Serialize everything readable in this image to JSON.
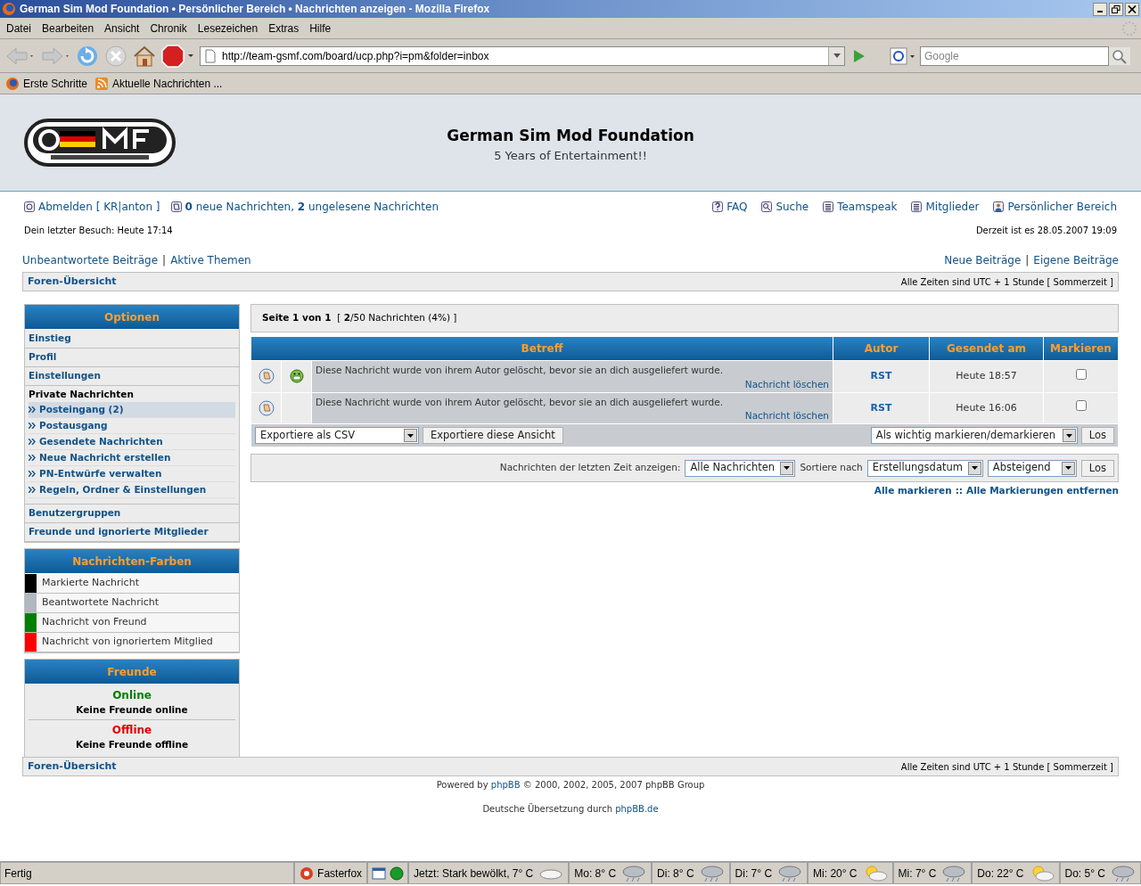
{
  "window": {
    "title": "German Sim Mod Foundation • Persönlicher Bereich • Nachrichten anzeigen - Mozilla Firefox"
  },
  "menu": [
    "Datei",
    "Bearbeiten",
    "Ansicht",
    "Chronik",
    "Lesezeichen",
    "Extras",
    "Hilfe"
  ],
  "toolbar": {
    "url": "http://team-gsmf.com/board/ucp.php?i=pm&folder=inbox",
    "search_placeholder": "Google"
  },
  "bookmarks": [
    "Erste Schritte",
    "Aktuelle Nachrichten ..."
  ],
  "header": {
    "title": "German Sim Mod Foundation",
    "subtitle": "5 Years of Entertainment!!"
  },
  "nav": {
    "logout": "Abmelden [ KR|anton ]",
    "messages": "**0** neue Nachrichten, **2** ungelesene Nachrichten",
    "right": [
      "FAQ",
      "Suche",
      "Teamspeak",
      "Mitglieder",
      "Persönlicher Bereich"
    ]
  },
  "last_visit": "Dein letzter Besuch: Heute 17:14",
  "current_time": "Derzeit ist es 28.05.2007 19:09",
  "quick_links": {
    "left": [
      "Unbeantwortete Beiträge",
      "|",
      "Aktive Themen"
    ],
    "right": [
      "Neue Beiträge",
      "|",
      "Eigene Beiträge"
    ]
  },
  "breadcrumb": {
    "label": "Foren-Übersicht",
    "timezone": "Alle Zeiten sind UTC + 1 Stunde [ Sommerzeit ]"
  },
  "options": {
    "title": "Optionen",
    "items": [
      {
        "kind": "link",
        "label": "Einstieg"
      },
      {
        "kind": "link",
        "label": "Profil"
      },
      {
        "kind": "link",
        "label": "Einstellungen"
      },
      {
        "kind": "heading",
        "label": "Private Nachrichten"
      },
      {
        "kind": "sub",
        "label": "Posteingang (2)",
        "selected": true
      },
      {
        "kind": "sub",
        "label": "Postausgang",
        "selected": false
      },
      {
        "kind": "sub",
        "label": "Gesendete Nachrichten",
        "selected": false
      },
      {
        "kind": "sub",
        "label": "Neue Nachricht erstellen",
        "selected": false
      },
      {
        "kind": "sub",
        "label": "PN-Entwürfe verwalten",
        "selected": false
      },
      {
        "kind": "sub",
        "label": "Regeln, Ordner & Einstellungen",
        "selected": false
      },
      {
        "kind": "link",
        "label": "Benutzergruppen"
      },
      {
        "kind": "link",
        "label": "Freunde und ignorierte Mitglieder"
      }
    ]
  },
  "message_colors": {
    "title": "Nachrichten-Farben",
    "items": [
      {
        "label": "Markierte Nachricht",
        "color": "#000000"
      },
      {
        "label": "Beantwortete Nachricht",
        "color": "#b0b8c0"
      },
      {
        "label": "Nachricht von Freund",
        "color": "#008000"
      },
      {
        "label": "Nachricht von ignoriertem Mitglied",
        "color": "#ff0000"
      }
    ]
  },
  "friends": {
    "title": "Freunde",
    "online": "Online",
    "online_text": "Keine Freunde online",
    "offline": "Offline",
    "offline_text": "Keine Freunde offline"
  },
  "pagination": "**Seite 1 von 1**  [ **2**/50 Nachrichten (4%) ]",
  "table": {
    "columns": [
      "Betreff",
      "Autor",
      "Gesendet am",
      "Markieren"
    ],
    "rows": [
      {
        "subject": "Diese Nachricht wurde von ihrem Autor gelöscht, bevor sie an dich ausgeliefert wurde.",
        "action": "Nachricht löschen",
        "author": "RST",
        "date": "Heute 18:57",
        "smiley": true,
        "checked": false
      },
      {
        "subject": "Diese Nachricht wurde von ihrem Autor gelöscht, bevor sie an dich ausgeliefert wurde.",
        "action": "Nachricht löschen",
        "author": "RST",
        "date": "Heute 16:06",
        "smiley": false,
        "checked": false
      }
    ]
  },
  "export": {
    "format": "Exportiere als CSV",
    "button": "Exportiere diese Ansicht",
    "mark_action": "Als wichtig markieren/demarkieren",
    "go": "Los"
  },
  "filter": {
    "label": "Nachrichten der letzten Zeit anzeigen:",
    "period": "Alle Nachrichten",
    "sort_label": "Sortiere nach",
    "sort": "Erstellungsdatum",
    "order": "Absteigend",
    "go": "Los"
  },
  "mark_links": [
    "Alle markieren",
    "::",
    "Alle Markierungen entfernen"
  ],
  "footer_breadcrumb": {
    "label": "Foren-Übersicht",
    "timezone": "Alle Zeiten sind UTC + 1 Stunde [ Sommerzeit ]"
  },
  "powered": {
    "text": "Powered by",
    "link": "phpBB",
    "rest": "© 2000, 2002, 2005, 2007 phpBB Group"
  },
  "translation": {
    "text": "Deutsche Übersetzung durch",
    "link": "phpBB.de"
  },
  "status_bar": {
    "status": "Fertig",
    "addon": "Fasterfox",
    "weather": [
      {
        "label": "Jetzt: Stark bewölkt, 7° C",
        "kind": "cloud"
      },
      {
        "label": "Mo: 8° C",
        "kind": "rain"
      },
      {
        "label": "Di: 8° C",
        "kind": "rain"
      },
      {
        "label": "Di: 7° C",
        "kind": "rain"
      },
      {
        "label": "Mi: 20° C",
        "kind": "sun"
      },
      {
        "label": "Mi: 7° C",
        "kind": "rain"
      },
      {
        "label": "Do: 22° C",
        "kind": "sun"
      },
      {
        "label": "Do: 5° C",
        "kind": "rain"
      }
    ]
  }
}
